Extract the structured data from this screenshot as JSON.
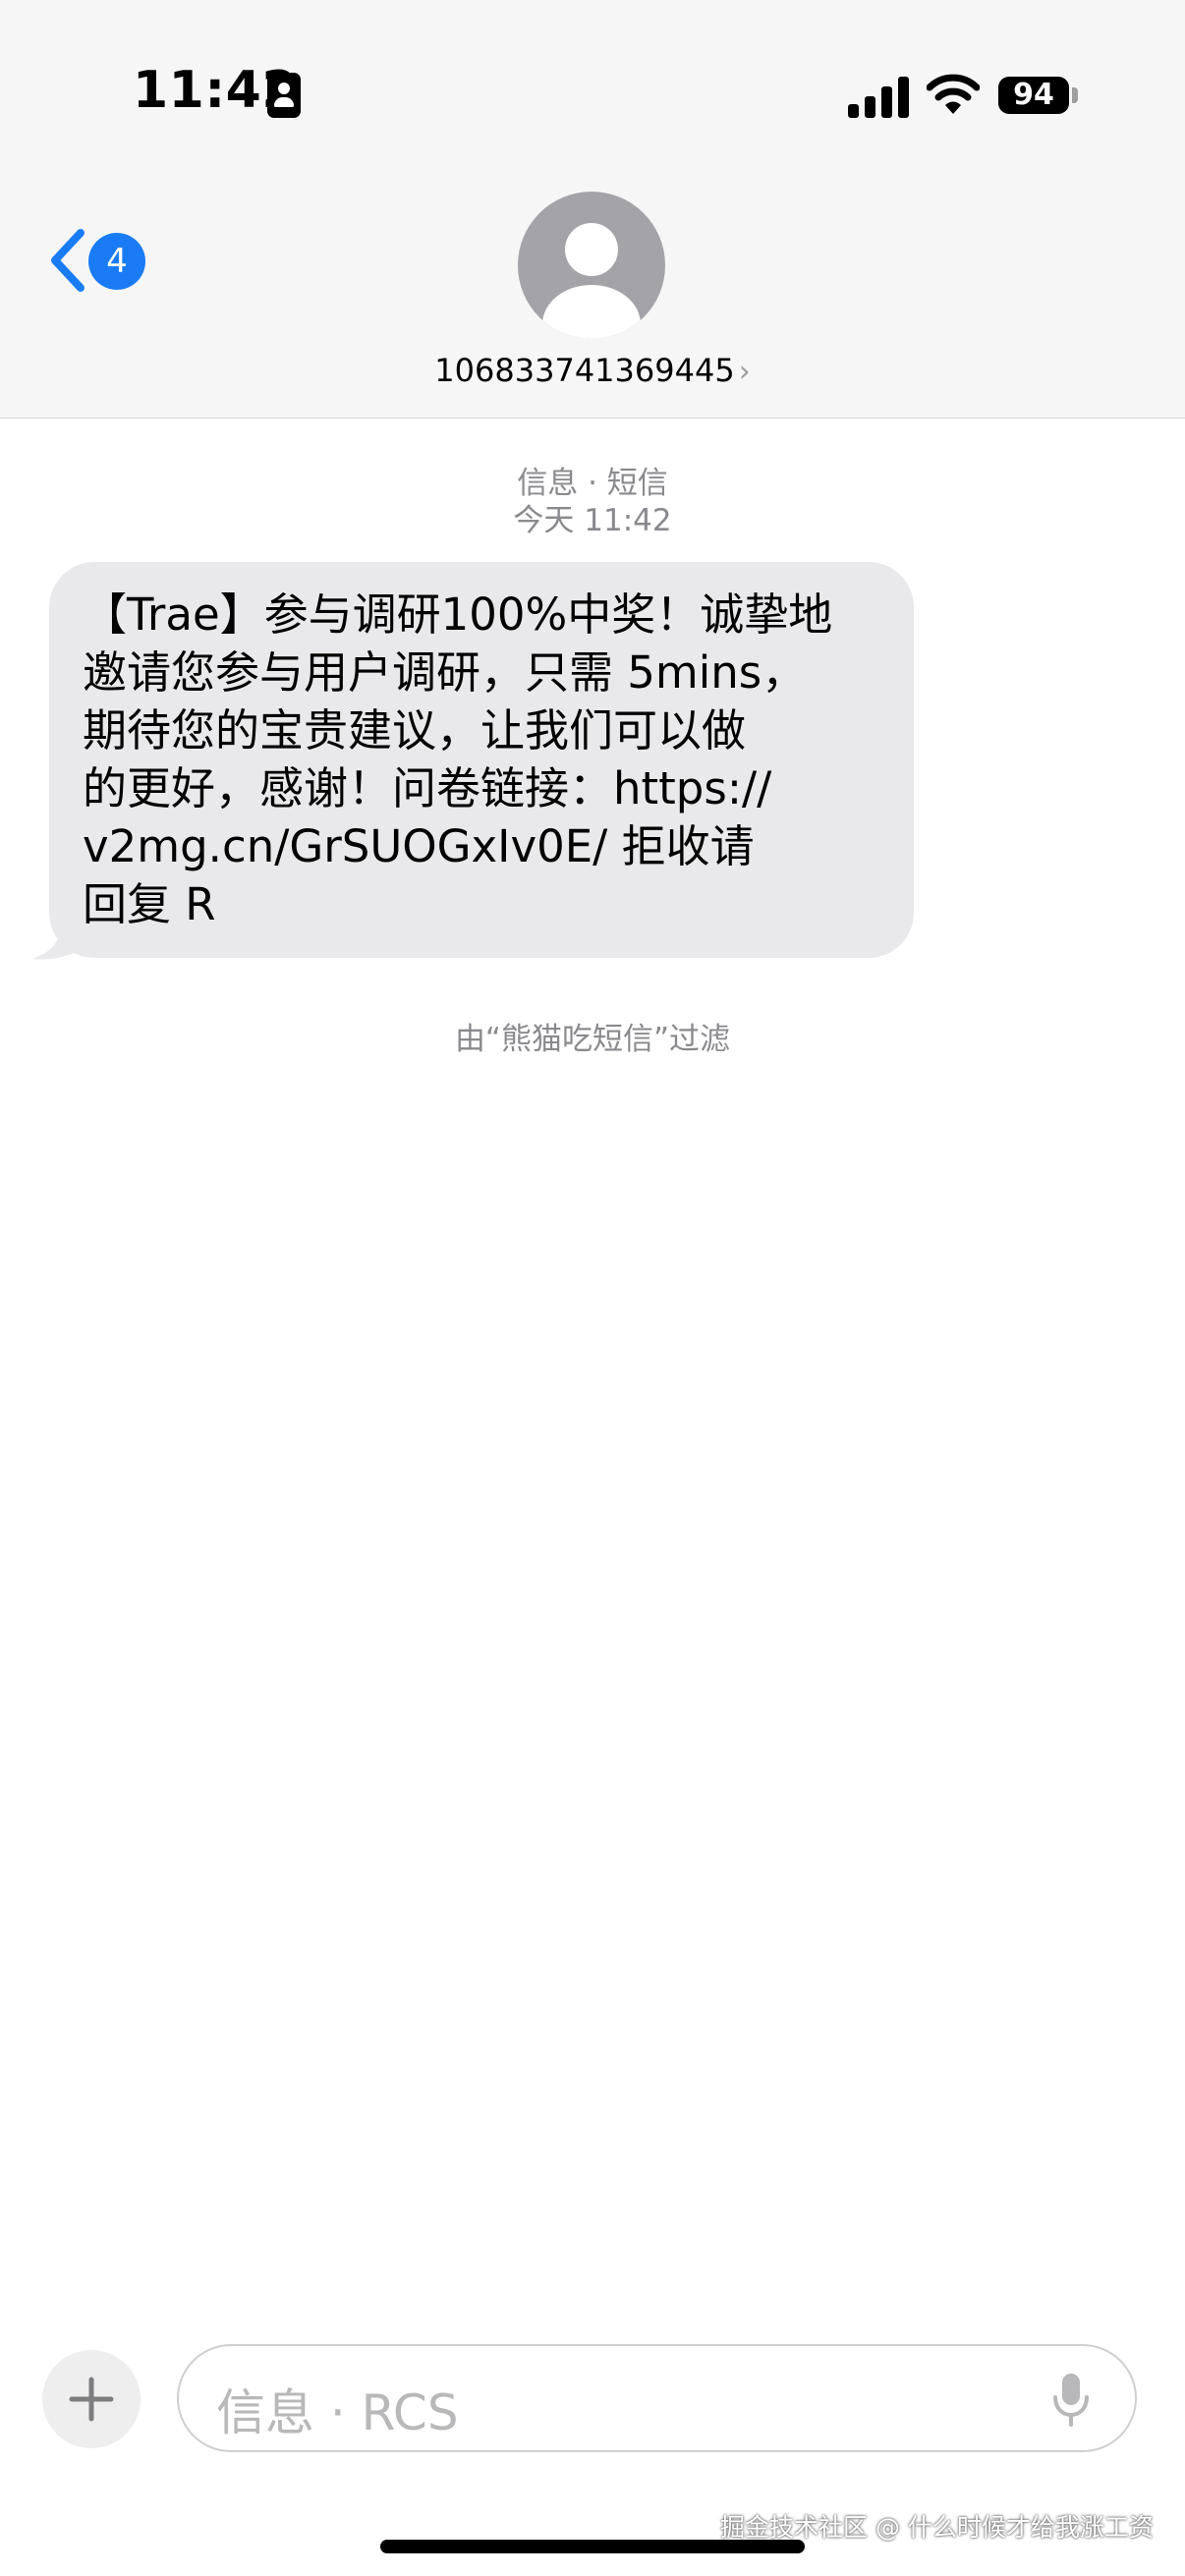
{
  "status_bar": {
    "time": "11:42",
    "battery": "94"
  },
  "nav": {
    "back_badge": "4",
    "contact_number": "106833741369445",
    "chevron": "›"
  },
  "conversation": {
    "service_label": "信息 · 短信",
    "timestamp": "今天 11:42",
    "message": "【Trae】参与调研100%中奖！诚挚地\n邀请您参与用户调研，只需 5mins，\n期待您的宝贵建议，让我们可以做\n的更好，感谢！问卷链接：https://\nv2mg.cn/GrSUOGxIv0E/ 拒收请\n回复 R",
    "filter_note": "由“熊猫吃短信”过滤"
  },
  "composer": {
    "placeholder": "信息 · RCS"
  },
  "watermark": "掘金技术社区 @ 什么时候才给我涨工资",
  "colors": {
    "accent": "#1a7cf5",
    "bubble": "#e9e9eb",
    "meta_text": "#8a8a8e"
  },
  "icons": [
    "id-card-icon",
    "signal-icon",
    "wifi-icon",
    "battery-icon",
    "back-chevron-icon",
    "contact-avatar-icon",
    "plus-icon",
    "microphone-icon"
  ]
}
